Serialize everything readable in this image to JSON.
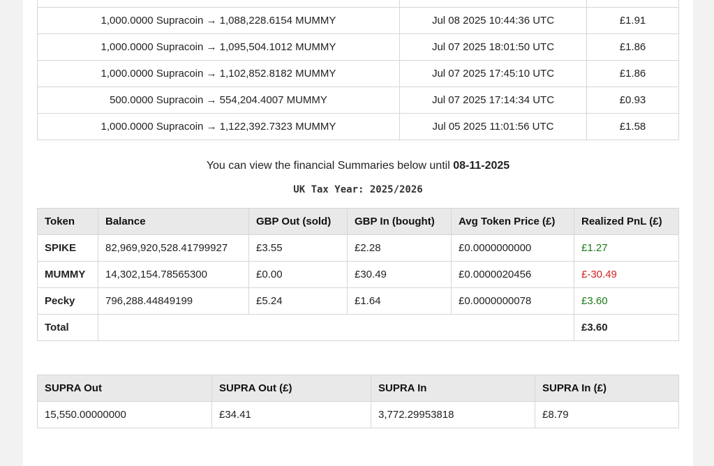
{
  "transactions": [
    {
      "swap": "",
      "date": "",
      "value": ""
    },
    {
      "swap": "1,000.0000 Supracoin → 1,088,228.6154 MUMMY",
      "date": "Jul 08 2025 10:44:36 UTC",
      "value": "£1.91"
    },
    {
      "swap": "1,000.0000 Supracoin → 1,095,504.1012 MUMMY",
      "date": "Jul 07 2025 18:01:50 UTC",
      "value": "£1.86"
    },
    {
      "swap": "1,000.0000 Supracoin → 1,102,852.8182 MUMMY",
      "date": "Jul 07 2025 17:45:10 UTC",
      "value": "£1.86"
    },
    {
      "swap": "500.0000 Supracoin → 554,204.4007 MUMMY",
      "date": "Jul 07 2025 17:14:34 UTC",
      "value": "£0.93"
    },
    {
      "swap": "1,000.0000 Supracoin → 1,122,392.7323 MUMMY",
      "date": "Jul 05 2025 11:01:56 UTC",
      "value": "£1.58"
    }
  ],
  "summary_note": {
    "text": "You can view the financial Summaries below until ",
    "date": "08-11-2025"
  },
  "tax_year": "UK Tax Year: 2025/2026",
  "pnl_table": {
    "headers": [
      "Token",
      "Balance",
      "GBP Out (sold)",
      "GBP In (bought)",
      "Avg Token Price (£)",
      "Realized PnL (£)"
    ],
    "rows": [
      {
        "token": "SPIKE",
        "balance": "82,969,920,528.41799927",
        "gbp_out": "£3.55",
        "gbp_in": "£2.28",
        "avg_price": "£0.0000000000",
        "pnl": "£1.27",
        "pnl_color": "#1a7a1a"
      },
      {
        "token": "MUMMY",
        "balance": "14,302,154.78565300",
        "gbp_out": "£0.00",
        "gbp_in": "£30.49",
        "avg_price": "£0.0000020456",
        "pnl": "£-30.49",
        "pnl_color": "#d42020"
      },
      {
        "token": "Pecky",
        "balance": "796,288.44849199",
        "gbp_out": "£5.24",
        "gbp_in": "£1.64",
        "avg_price": "£0.0000000078",
        "pnl": "£3.60",
        "pnl_color": "#1a7a1a"
      }
    ],
    "total_label": "Total",
    "total_value": "£3.60"
  },
  "supra_table": {
    "headers": [
      "SUPRA Out",
      "SUPRA Out (£)",
      "SUPRA In",
      "SUPRA In (£)"
    ],
    "values": [
      "15,550.00000000",
      "£34.41",
      "3,772.29953818",
      "£8.79"
    ]
  }
}
